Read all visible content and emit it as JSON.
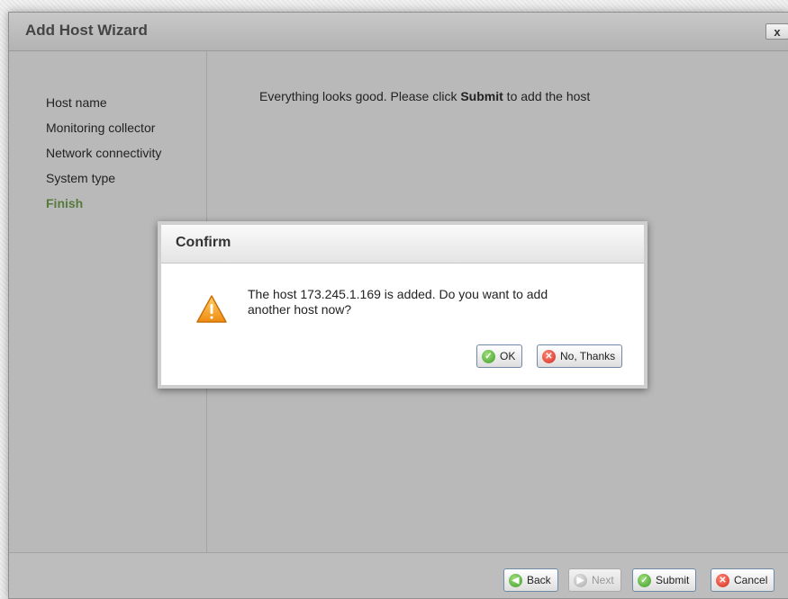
{
  "wizard": {
    "title": "Add Host Wizard",
    "close_label": "x",
    "steps": [
      {
        "label": "Host name"
      },
      {
        "label": "Monitoring collector"
      },
      {
        "label": "Network connectivity"
      },
      {
        "label": "System type"
      },
      {
        "label": "Finish",
        "active": true
      }
    ],
    "message_pre": "Everything looks good. Please click ",
    "message_bold": "Submit",
    "message_post": " to add the host",
    "footer": {
      "back_label": "Back",
      "next_label": "Next",
      "submit_label": "Submit",
      "cancel_label": "Cancel"
    }
  },
  "confirm": {
    "title": "Confirm",
    "message": "The host 173.245.1.169 is added. Do you want to add another host now?",
    "ok_label": "OK",
    "no_label": "No, Thanks"
  },
  "colors": {
    "active_step": "#567a3a",
    "button_border": "#6f8aa8",
    "ok_icon": "#3f9a2a",
    "cancel_icon": "#d42a1a",
    "warning": "#f0a020"
  },
  "icons": {
    "back": "back-arrow-icon",
    "next": "next-arrow-icon",
    "submit": "check-icon",
    "cancel": "x-icon",
    "warning": "warning-icon"
  }
}
